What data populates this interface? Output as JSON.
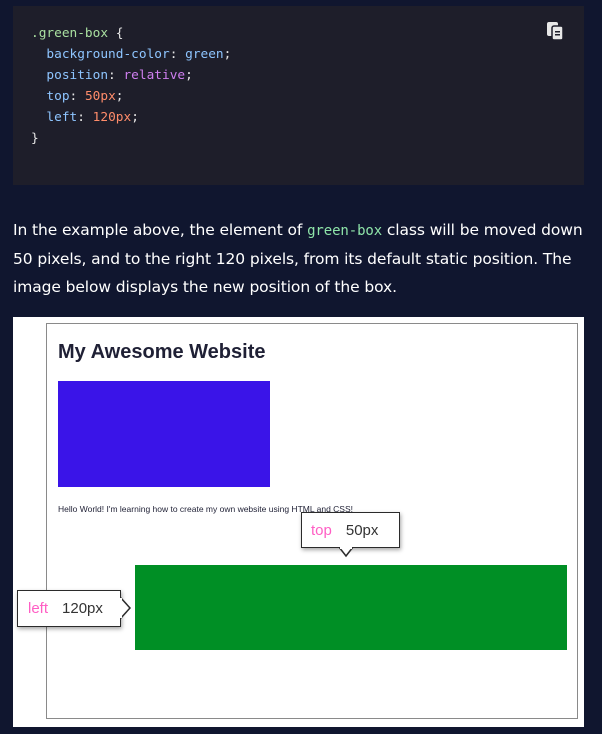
{
  "code_block": {
    "lines": [
      [
        {
          "t": ".green-box",
          "c": "sel"
        },
        {
          "t": " {",
          "c": "punc"
        }
      ],
      [
        {
          "t": "  background-color",
          "c": "prop"
        },
        {
          "t": ": ",
          "c": "punc"
        },
        {
          "t": "green",
          "c": "prop"
        },
        {
          "t": ";",
          "c": "punc"
        }
      ],
      [
        {
          "t": "  position",
          "c": "prop"
        },
        {
          "t": ": ",
          "c": "punc"
        },
        {
          "t": "relative",
          "c": "val"
        },
        {
          "t": ";",
          "c": "punc"
        }
      ],
      [
        {
          "t": "  top",
          "c": "prop"
        },
        {
          "t": ": ",
          "c": "punc"
        },
        {
          "t": "50px",
          "c": "num"
        },
        {
          "t": ";",
          "c": "punc"
        }
      ],
      [
        {
          "t": "  left",
          "c": "prop"
        },
        {
          "t": ": ",
          "c": "punc"
        },
        {
          "t": "120px",
          "c": "num"
        },
        {
          "t": ";",
          "c": "punc"
        }
      ],
      [
        {
          "t": "}",
          "c": "punc"
        }
      ]
    ],
    "copy_icon": "copy-icon"
  },
  "paragraph": {
    "before": "In the example above, the element of ",
    "code": "green-box",
    "after": " class will be moved down 50 pixels, and to the right 120 pixels, from its default static position. The image below displays the new position of the box."
  },
  "figure": {
    "site_title": "My Awesome Website",
    "hello_text": "Hello World! I'm learning how to create my own website using HTML and CSS!",
    "top_tip": {
      "keyword": "top",
      "value": "50px"
    },
    "left_tip": {
      "keyword": "left",
      "value": "120px"
    },
    "colors": {
      "blue_box": "#3a14e8",
      "green_box": "#008f25",
      "keyword": "#ff5ec4"
    }
  }
}
